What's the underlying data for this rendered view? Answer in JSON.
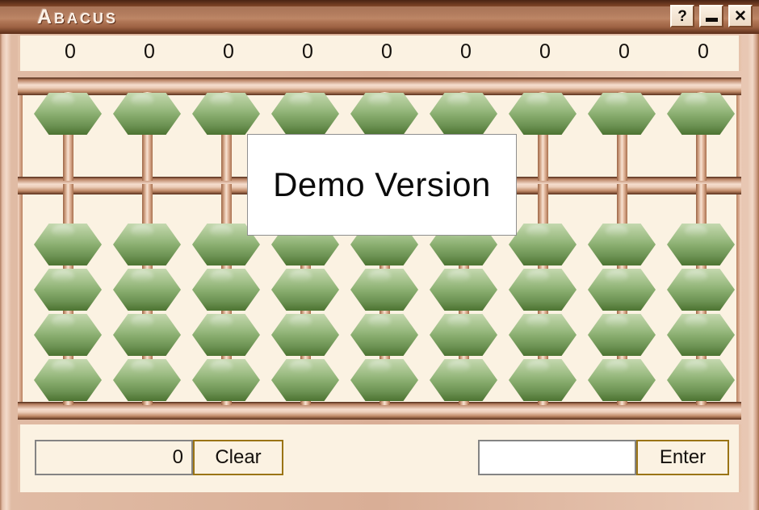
{
  "window": {
    "title": "Abacus",
    "controls": [
      {
        "name": "help-button",
        "glyph": "?",
        "label": "?"
      },
      {
        "name": "minimize-button",
        "glyph": "_",
        "label": "Minimize"
      },
      {
        "name": "close-button",
        "glyph": "✕",
        "label": "X"
      }
    ]
  },
  "display": {
    "digits": [
      "0",
      "0",
      "0",
      "0",
      "0",
      "0",
      "0",
      "0",
      "0"
    ]
  },
  "abacus": {
    "columns": 9,
    "heaven_beads_per_column": 1,
    "earth_beads_per_column": 4,
    "bead_color": "#84a96a",
    "frame_color": "#c08a68",
    "board_color": "#fbf2e2",
    "column_values": [
      0,
      0,
      0,
      0,
      0,
      0,
      0,
      0,
      0
    ]
  },
  "overlay": {
    "demo_text": "Demo Version"
  },
  "controls": {
    "value_display": "0",
    "clear_label": "Clear",
    "input_value": "",
    "input_placeholder": "",
    "enter_label": "Enter"
  }
}
